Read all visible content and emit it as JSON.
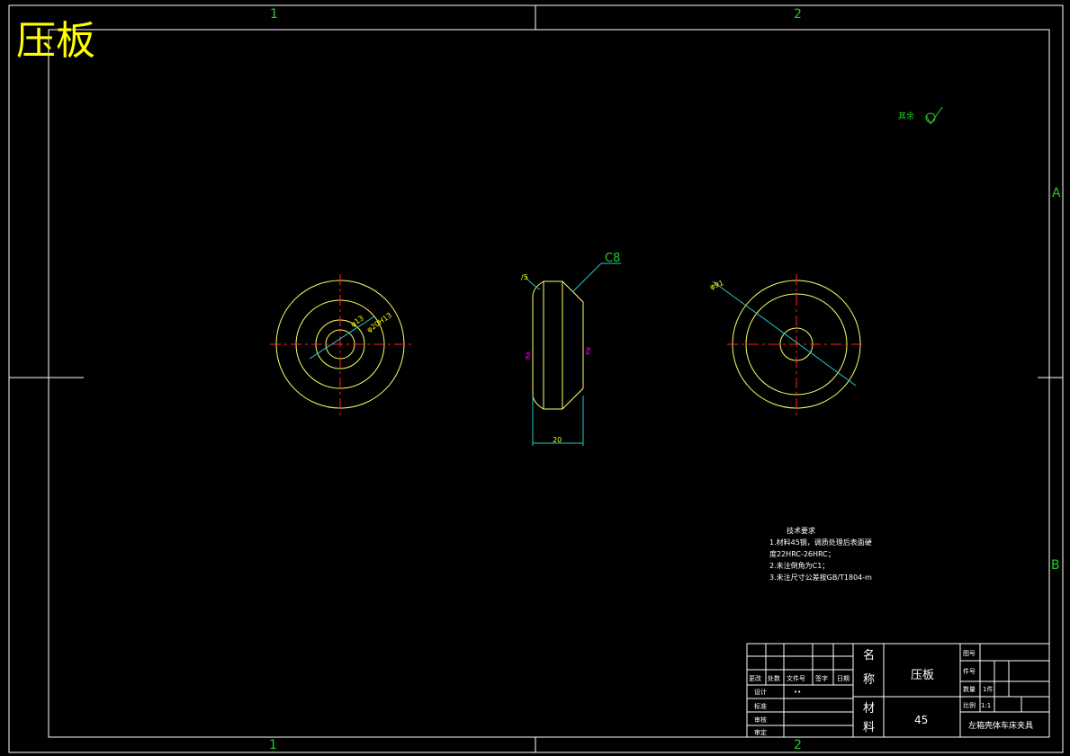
{
  "title": "压板",
  "colors": {
    "background": "#000000",
    "frame": "#ffffff",
    "geometry": "#ffff66",
    "centerline": "#ff2222",
    "dimension": "#22cccc",
    "zone_label": "#22cc22",
    "title_text": "#ffff00",
    "magenta": "#ff00ff"
  },
  "zones": {
    "top": [
      "1",
      "2"
    ],
    "bottom": [
      "1",
      "2"
    ],
    "right": [
      "A",
      "B"
    ]
  },
  "side_view": {
    "chamfer_label": "C8",
    "width_dim": "20",
    "angle_label": "∕5",
    "left_tol": "Ra",
    "right_tol": "Ra"
  },
  "left_view": {
    "dim_inner": "φ13",
    "dim_outer": "φ20H13"
  },
  "right_view": {
    "dim_diameter": "φ91"
  },
  "surface_finish_note": "其余",
  "tech_requirements": {
    "heading": "技术要求",
    "lines": [
      "1.材料45钢，调质处理后表面硬",
      "度22HRC-26HRC；",
      "2.未注倒角为C1；",
      "3.未注尺寸公差按GB/T1804-m"
    ]
  },
  "title_block": {
    "name_label": [
      "名",
      "称"
    ],
    "part_name": "压板",
    "material_label": [
      "材",
      "料"
    ],
    "material": "45",
    "drawing_no_label": "图号",
    "item_no_label": "件号",
    "quantity_label": "数量",
    "quantity": "1件",
    "scale_label": "比例",
    "scale": "1:1",
    "project": "左箱壳体车床夹具",
    "rev_headers": [
      "更改",
      "处数",
      "文件号",
      "签字",
      "日期"
    ],
    "rows": [
      "设计",
      "标准",
      "审核",
      "审定"
    ],
    "designer_mark": "••"
  }
}
